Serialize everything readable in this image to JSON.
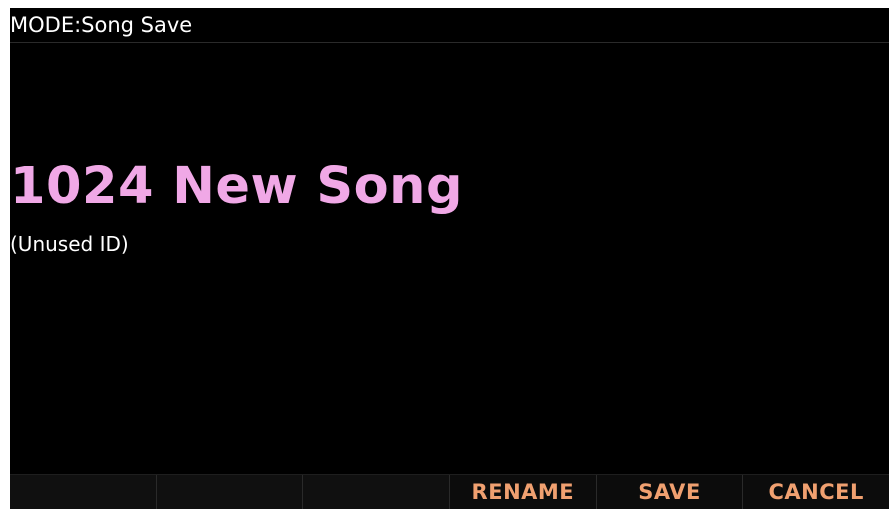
{
  "header": {
    "mode_label": "MODE:",
    "mode_value": "Song Save"
  },
  "song": {
    "id": "1024",
    "name": "New Song",
    "status": "(Unused ID)"
  },
  "softkeys": [
    "",
    "",
    "",
    "RENAME",
    "SAVE",
    "CANCEL"
  ],
  "colors": {
    "background": "#000000",
    "name_text": "#f0a8e6",
    "softkey_text": "#f0a070",
    "header_text": "#ffffff"
  }
}
